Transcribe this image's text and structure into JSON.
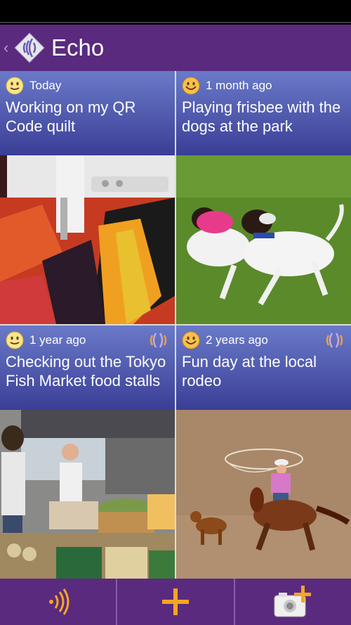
{
  "app": {
    "title": "Echo"
  },
  "colors": {
    "bar": "#5a2a7e",
    "tile_top": "#6a7ac8",
    "tile_bottom": "#3a3e96",
    "accent": "#f5a623"
  },
  "memories": [
    {
      "when": "Today",
      "caption": "Working on my QR Code quilt",
      "mood_icon": "neutral-smiley-icon",
      "has_echo": false,
      "photo": "sewing-machine-quilt-photo"
    },
    {
      "when": "1 month ago",
      "caption": "Playing frisbee with the dogs at the  park",
      "mood_icon": "happy-smiley-icon",
      "has_echo": false,
      "photo": "dogs-frisbee-photo"
    },
    {
      "when": "1 year ago",
      "caption": "Checking out the Tokyo Fish Market food stalls",
      "mood_icon": "neutral-smiley-icon",
      "has_echo": true,
      "photo": "fish-market-stalls-photo"
    },
    {
      "when": "2 years ago",
      "caption": "Fun day at the local rodeo",
      "mood_icon": "happy-smiley-icon",
      "has_echo": true,
      "photo": "rodeo-roping-photo"
    }
  ],
  "bottom_bar": [
    {
      "icon": "echo-waves-icon"
    },
    {
      "icon": "plus-icon"
    },
    {
      "icon": "add-photo-camera-icon"
    }
  ]
}
